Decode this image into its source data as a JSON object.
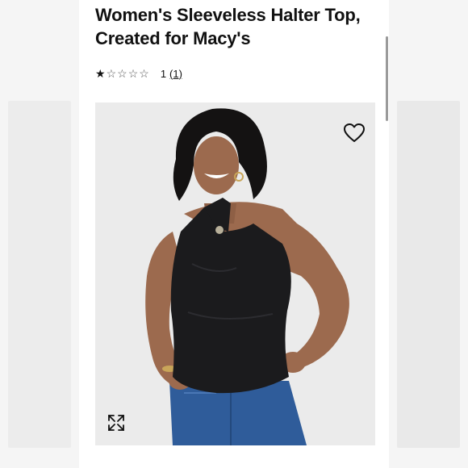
{
  "product": {
    "title": "Women's Sleeveless Halter Top, Created for Macy's",
    "rating": {
      "stars_filled": 1,
      "stars_total": 5,
      "value_text": "1",
      "review_count_text": "(1)"
    },
    "image": {
      "alt": "Model wearing black sleeveless halter top with jeans",
      "wishlist_icon": "heart-icon",
      "expand_icon": "expand-icon"
    }
  },
  "colors": {
    "top_fabric": "#1b1b1d",
    "denim": "#2f5c9a",
    "background": "#ebebeb"
  }
}
